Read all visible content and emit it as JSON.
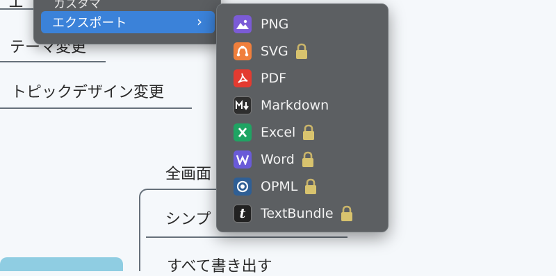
{
  "mindmap": {
    "branch_top_partial": "エ",
    "branch_theme": "テーマ変更",
    "branch_topic_design": "トピックデザイン変更",
    "child_fullscreen": "全画面",
    "child_simple": "シンプ",
    "child_export_all": "すべて書き出す"
  },
  "parent_menu": {
    "previous_item": "カスタマ",
    "selected_item": "エクスポート",
    "selected_color": "#3b82d9"
  },
  "export_menu": {
    "items": [
      {
        "label": "PNG",
        "icon": "image-icon",
        "color": "#7b5bd6",
        "locked": false
      },
      {
        "label": "SVG",
        "icon": "svg-icon",
        "color": "#f07f3c",
        "locked": true
      },
      {
        "label": "PDF",
        "icon": "pdf-icon",
        "color": "#e33b30",
        "locked": false
      },
      {
        "label": "Markdown",
        "icon": "markdown-icon",
        "color": "#2e2e2e",
        "locked": false
      },
      {
        "label": "Excel",
        "icon": "excel-icon",
        "color": "#1fa463",
        "locked": true
      },
      {
        "label": "Word",
        "icon": "word-icon",
        "color": "#6a5bd8",
        "locked": true
      },
      {
        "label": "OPML",
        "icon": "opml-icon",
        "color": "#2f5f95",
        "locked": true
      },
      {
        "label": "TextBundle",
        "icon": "textbundle-icon",
        "color": "#222222",
        "locked": true
      }
    ]
  }
}
